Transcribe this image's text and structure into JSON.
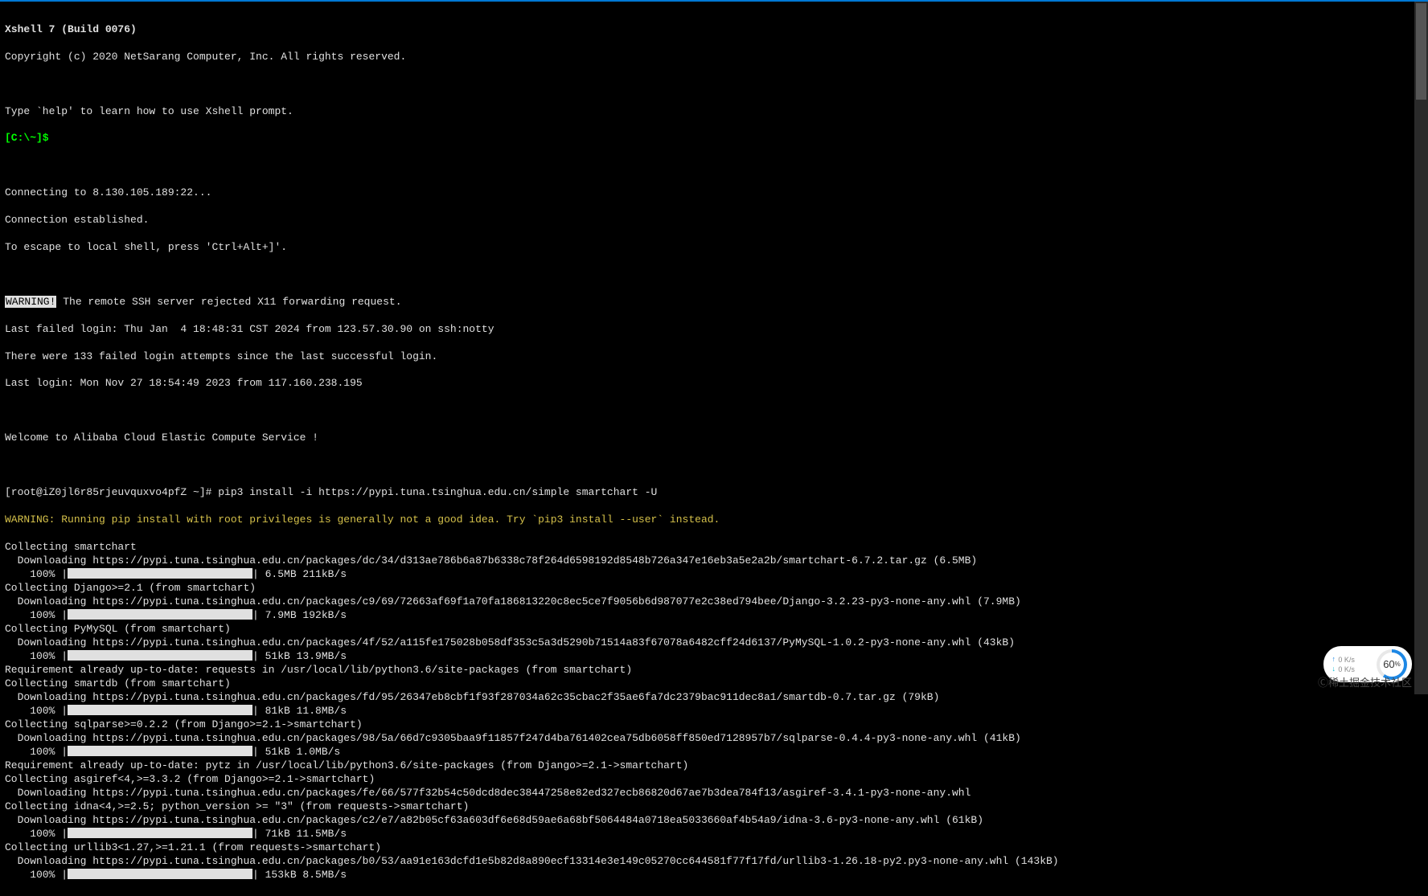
{
  "header": {
    "app_title": "Xshell 7 (Build 0076)",
    "copyright": "Copyright (c) 2020 NetSarang Computer, Inc. All rights reserved.",
    "help_hint": "Type `help' to learn how to use Xshell prompt.",
    "prompt": "[C:\\~]$"
  },
  "connection": {
    "connecting": "Connecting to 8.130.105.189:22...",
    "established": "Connection established.",
    "escape_hint": "To escape to local shell, press 'Ctrl+Alt+]'."
  },
  "warning": {
    "label": "WARNING!",
    "x11": " The remote SSH server rejected X11 forwarding request.",
    "last_failed": "Last failed login: Thu Jan  4 18:48:31 CST 2024 from 123.57.30.90 on ssh:notty",
    "failed_attempts": "There were 133 failed login attempts since the last successful login.",
    "last_login": "Last login: Mon Nov 27 18:54:49 2023 from 117.160.238.195"
  },
  "welcome": "Welcome to Alibaba Cloud Elastic Compute Service !",
  "shell": {
    "prompt": "[root@iZ0jl6r85rjeuvquxvo4pfZ ~]# ",
    "command": "pip3 install -i https://pypi.tuna.tsinghua.edu.cn/simple smartchart -U",
    "pip_warning": "WARNING: Running pip install with root privileges is generally not a good idea. Try `pip3 install --user` instead."
  },
  "packages": [
    {
      "collecting": "Collecting smartchart",
      "downloading": "  Downloading https://pypi.tuna.tsinghua.edu.cn/packages/dc/34/d313ae786b6a87b6338c78f264d6598192d8548b726a347e16eb3a5e2a2b/smartchart-6.7.2.tar.gz (6.5MB)",
      "progress": "    100% |",
      "progress_suffix": "| 6.5MB 211kB/s"
    },
    {
      "collecting": "Collecting Django>=2.1 (from smartchart)",
      "downloading": "  Downloading https://pypi.tuna.tsinghua.edu.cn/packages/c9/69/72663af69f1a70fa186813220c8ec5ce7f9056b6d987077e2c38ed794bee/Django-3.2.23-py3-none-any.whl (7.9MB)",
      "progress": "    100% |",
      "progress_suffix": "| 7.9MB 192kB/s"
    },
    {
      "collecting": "Collecting PyMySQL (from smartchart)",
      "downloading": "  Downloading https://pypi.tuna.tsinghua.edu.cn/packages/4f/52/a115fe175028b058df353c5a3d5290b71514a83f67078a6482cff24d6137/PyMySQL-1.0.2-py3-none-any.whl (43kB)",
      "progress": "    100% |",
      "progress_suffix": "| 51kB 13.9MB/s"
    },
    {
      "requirement": "Requirement already up-to-date: requests in /usr/local/lib/python3.6/site-packages (from smartchart)"
    },
    {
      "collecting": "Collecting smartdb (from smartchart)",
      "downloading": "  Downloading https://pypi.tuna.tsinghua.edu.cn/packages/fd/95/26347eb8cbf1f93f287034a62c35cbac2f35ae6fa7dc2379bac911dec8a1/smartdb-0.7.tar.gz (79kB)",
      "progress": "    100% |",
      "progress_suffix": "| 81kB 11.8MB/s"
    },
    {
      "collecting": "Collecting sqlparse>=0.2.2 (from Django>=2.1->smartchart)",
      "downloading": "  Downloading https://pypi.tuna.tsinghua.edu.cn/packages/98/5a/66d7c9305baa9f11857f247d4ba761402cea75db6058ff850ed7128957b7/sqlparse-0.4.4-py3-none-any.whl (41kB)",
      "progress": "    100% |",
      "progress_suffix": "| 51kB 1.0MB/s"
    },
    {
      "requirement": "Requirement already up-to-date: pytz in /usr/local/lib/python3.6/site-packages (from Django>=2.1->smartchart)"
    },
    {
      "collecting": "Collecting asgiref<4,>=3.3.2 (from Django>=2.1->smartchart)",
      "downloading": "  Downloading https://pypi.tuna.tsinghua.edu.cn/packages/fe/66/577f32b54c50dcd8dec38447258e82ed327ecb86820d67ae7b3dea784f13/asgiref-3.4.1-py3-none-any.whl"
    },
    {
      "collecting": "Collecting idna<4,>=2.5; python_version >= \"3\" (from requests->smartchart)",
      "downloading": "  Downloading https://pypi.tuna.tsinghua.edu.cn/packages/c2/e7/a82b05cf63a603df6e68d59ae6a68bf5064484a0718ea5033660af4b54a9/idna-3.6-py3-none-any.whl (61kB)",
      "progress": "    100% |",
      "progress_suffix": "| 71kB 11.5MB/s"
    },
    {
      "collecting": "Collecting urllib3<1.27,>=1.21.1 (from requests->smartchart)",
      "downloading": "  Downloading https://pypi.tuna.tsinghua.edu.cn/packages/b0/53/aa91e163dcfd1e5b82d8a890ecf13314e3e149c05270cc644581f77f17fd/urllib3-1.26.18-py2.py3-none-any.whl (143kB)",
      "progress": "    100% |",
      "progress_suffix": "| 153kB 8.5MB/s"
    }
  ],
  "widget": {
    "up_speed": "0  K/s",
    "down_speed": "0  K/s",
    "percent": "60",
    "percent_suffix": "%"
  },
  "watermark": "Ⓒ稀土掘金技术社区"
}
